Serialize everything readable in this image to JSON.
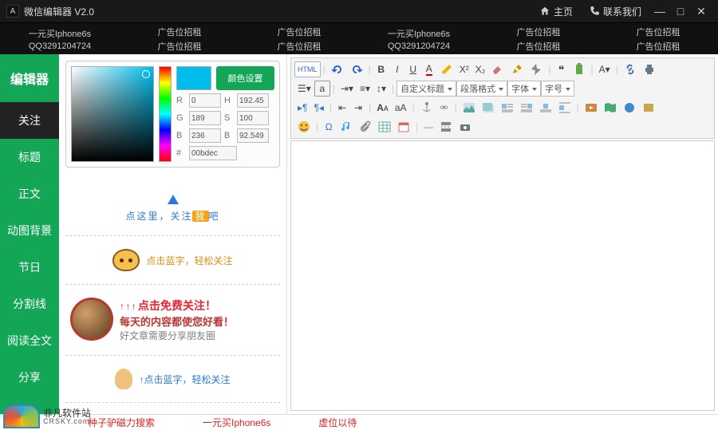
{
  "titlebar": {
    "logo_glyph": "A",
    "title": "微信编辑器  V2.0",
    "links": {
      "home": "主页",
      "contact": "联系我们"
    }
  },
  "ads": {
    "iphone": "一元买Iphone6s",
    "qq": "QQ3291204724",
    "rent": "广告位招租"
  },
  "sidebar": {
    "items": [
      {
        "label": "编辑器",
        "big": true,
        "active": false
      },
      {
        "label": "关注",
        "big": false,
        "active": true
      },
      {
        "label": "标题",
        "big": false,
        "active": false
      },
      {
        "label": "正文",
        "big": false,
        "active": false
      },
      {
        "label": "动图背景",
        "big": false,
        "active": false
      },
      {
        "label": "节日",
        "big": false,
        "active": false
      },
      {
        "label": "分割线",
        "big": false,
        "active": false
      },
      {
        "label": "阅读全文",
        "big": false,
        "active": false
      },
      {
        "label": "分享",
        "big": false,
        "active": false
      }
    ]
  },
  "colorpicker": {
    "button": "颜色设置",
    "R": "0",
    "H": "192.45",
    "G": "189",
    "S": "100",
    "B": "236",
    "Br": "92.549",
    "hex": "00bdec",
    "preview": "#00bdec"
  },
  "templates": {
    "t1_a": "点这里，关注",
    "t1_hl": "我",
    "t1_b": "吧",
    "t2": "点击蓝字，轻松关注",
    "t3_arrows": "↑ ↑ ↑",
    "t3_l1": "点击免费关注！",
    "t3_l2": "每天的内容都使您好看！",
    "t3_l3": "好文章需要分享朋友圈",
    "t4": "↑点击蓝字，轻松关注"
  },
  "toolbar": {
    "html": "HTML",
    "sel_custom": "自定义标题",
    "sel_para": "段落格式",
    "sel_font": "字体",
    "sel_size": "字号",
    "box_a": "a"
  },
  "bottom": {
    "l1": "种子驴磁力搜索",
    "l2": "一元买Iphone6s",
    "l3": "虚位以待"
  },
  "watermark": {
    "cn": "非凡软件站",
    "en": "CRSKY.com"
  }
}
